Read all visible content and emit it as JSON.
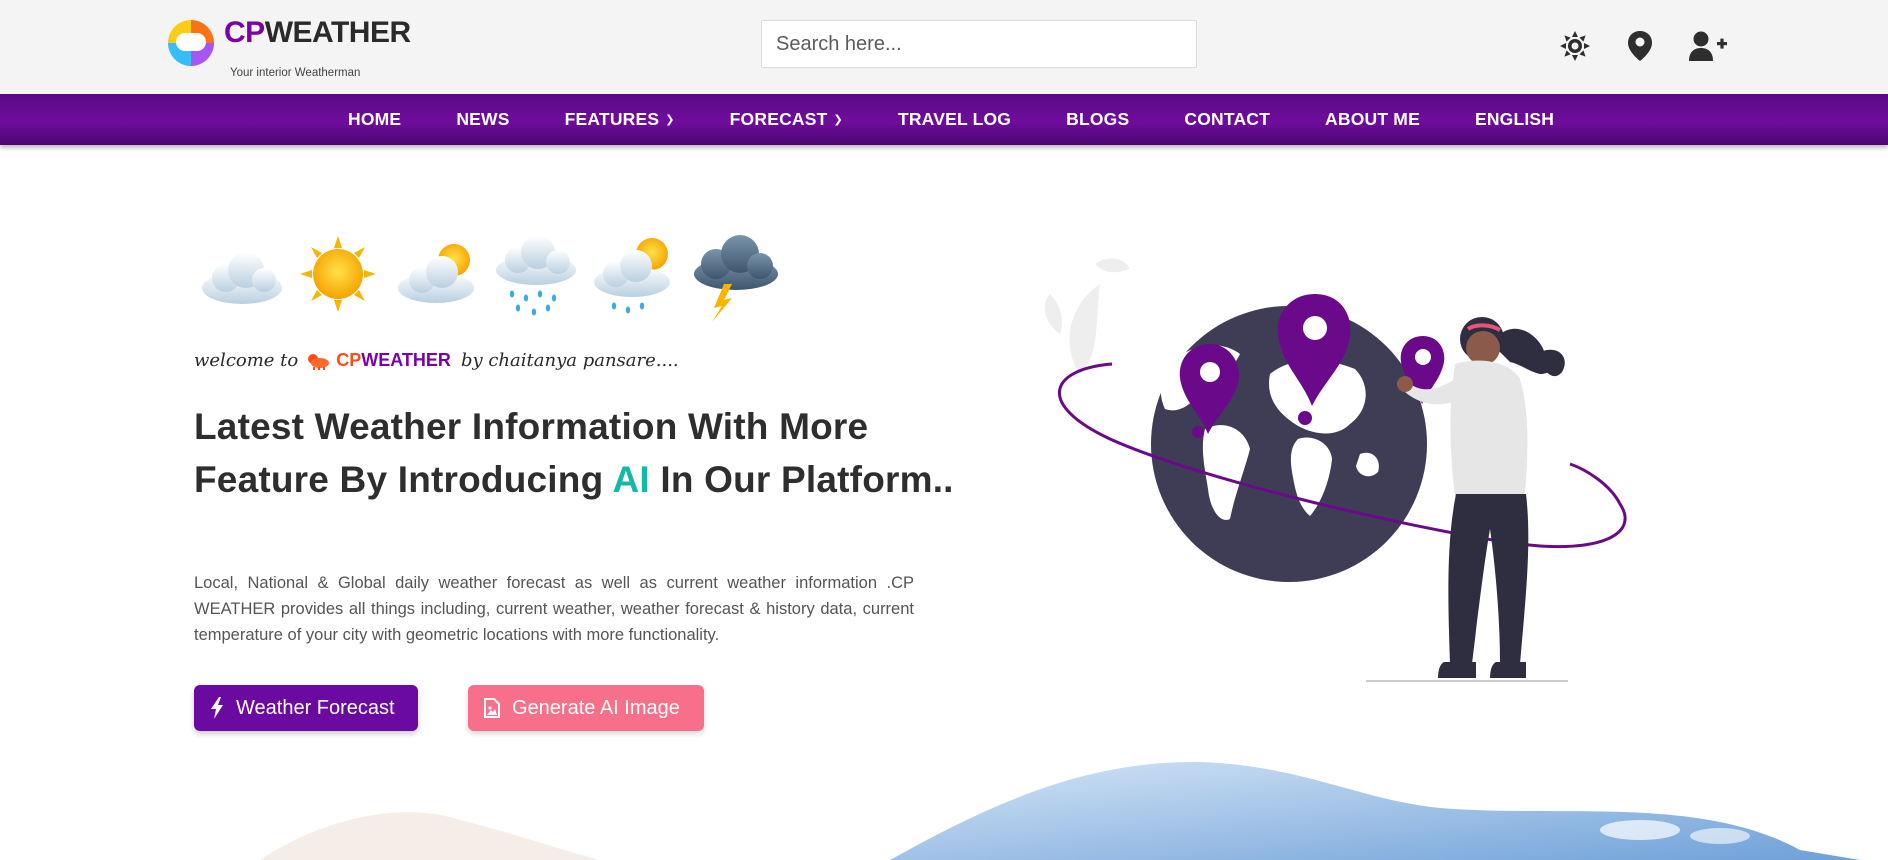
{
  "header": {
    "brand_cp": "CP",
    "brand_rest": "WEATHER",
    "tagline": "Your interior Weatherman",
    "search_placeholder": "Search here...",
    "icons": [
      "sun-icon",
      "map-pin-icon",
      "user-plus-icon"
    ]
  },
  "nav": {
    "items": [
      {
        "label": "HOME"
      },
      {
        "label": "NEWS"
      },
      {
        "label": "FEATURES",
        "dropdown": true
      },
      {
        "label": "FORECAST",
        "dropdown": true
      },
      {
        "label": "TRAVEL LOG"
      },
      {
        "label": "BLOGS"
      },
      {
        "label": "CONTACT"
      },
      {
        "label": "ABOUT ME"
      },
      {
        "label": "ENGLISH"
      }
    ]
  },
  "hero": {
    "weather_icons": [
      "cloud-icon",
      "sun-icon",
      "partly-cloudy-icon",
      "rain-cloud-icon",
      "sun-rain-icon",
      "thunderstorm-icon"
    ],
    "welcome_prefix": "welcome to",
    "welcome_brand_cp": "CP",
    "welcome_brand_rest": "WEATHER",
    "welcome_suffix": "by chaitanya pansare....",
    "headline_part1": "Latest Weather Information With More Feature By Introducing",
    "headline_ai": "AI",
    "headline_part2": "In Our Platform..",
    "description": "Local, National & Global daily weather forecast as well as current weather information .CP WEATHER provides all things including, current weather, weather forecast & history data, current temperature of your city with geometric locations with more functionality.",
    "primary_button": "Weather Forecast",
    "secondary_button": "Generate AI Image"
  },
  "colors": {
    "brand_purple": "#6a0aa0",
    "nav_purple": "#5a0a86",
    "accent_teal": "#14b8a6",
    "accent_pink": "#f76f8a",
    "accent_orange": "#ff4d1a"
  }
}
